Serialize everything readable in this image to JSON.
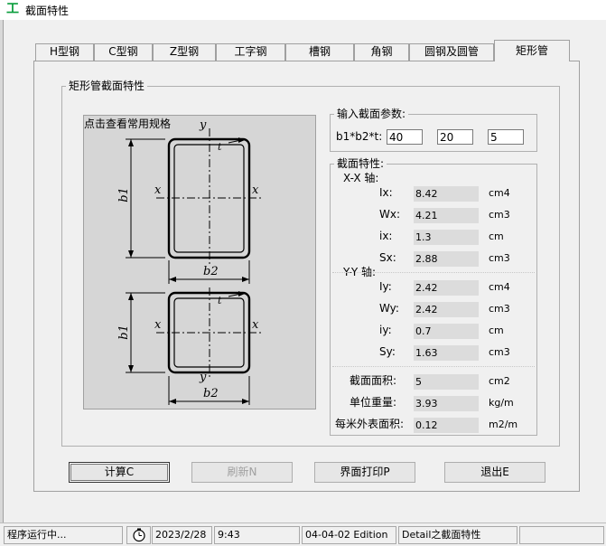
{
  "window": {
    "title": "截面特性",
    "app_icon": "工"
  },
  "tabs": [
    "H型钢",
    "C型钢",
    "Z型钢",
    "工字钢",
    "槽钢",
    "角钢",
    "圆钢及圆管",
    "矩形管"
  ],
  "section": {
    "title": "矩形管截面特性",
    "drawing_label": "点击查看常用规格",
    "drawing_symbols": {
      "x": "x",
      "y": "y",
      "t": "t",
      "b1": "b1",
      "b2": "b2"
    }
  },
  "input": {
    "group_title": "输入截面参数:",
    "param_label": "b1*b2*t:",
    "b1": "40",
    "b2": "20",
    "t": "5"
  },
  "properties": {
    "group_title": "截面特性:",
    "xx_label": "X-X 轴:",
    "yy_label": "Y-Y 轴:",
    "xx": [
      {
        "label": "Ix:",
        "value": "8.42",
        "unit": "cm4"
      },
      {
        "label": "Wx:",
        "value": "4.21",
        "unit": "cm3"
      },
      {
        "label": "ix:",
        "value": "1.3",
        "unit": "cm"
      },
      {
        "label": "Sx:",
        "value": "2.88",
        "unit": "cm3"
      }
    ],
    "yy": [
      {
        "label": "Iy:",
        "value": "2.42",
        "unit": "cm4"
      },
      {
        "label": "Wy:",
        "value": "2.42",
        "unit": "cm3"
      },
      {
        "label": "iy:",
        "value": "0.7",
        "unit": "cm"
      },
      {
        "label": "Sy:",
        "value": "1.63",
        "unit": "cm3"
      }
    ],
    "summary": [
      {
        "label": "截面面积:",
        "value": "5",
        "unit": "cm2"
      },
      {
        "label": "单位重量:",
        "value": "3.93",
        "unit": "kg/m"
      },
      {
        "label": "每米外表面积:",
        "value": "0.12",
        "unit": "m2/m"
      }
    ]
  },
  "buttons": {
    "calc": "计算C",
    "refresh": "刷新N",
    "print": "界面打印P",
    "exit": "退出E"
  },
  "status": {
    "message": "程序运行中...",
    "date": "2023/2/28",
    "time": "9:43",
    "edition": "04-04-02 Edition",
    "context": "Detail之截面特性"
  }
}
